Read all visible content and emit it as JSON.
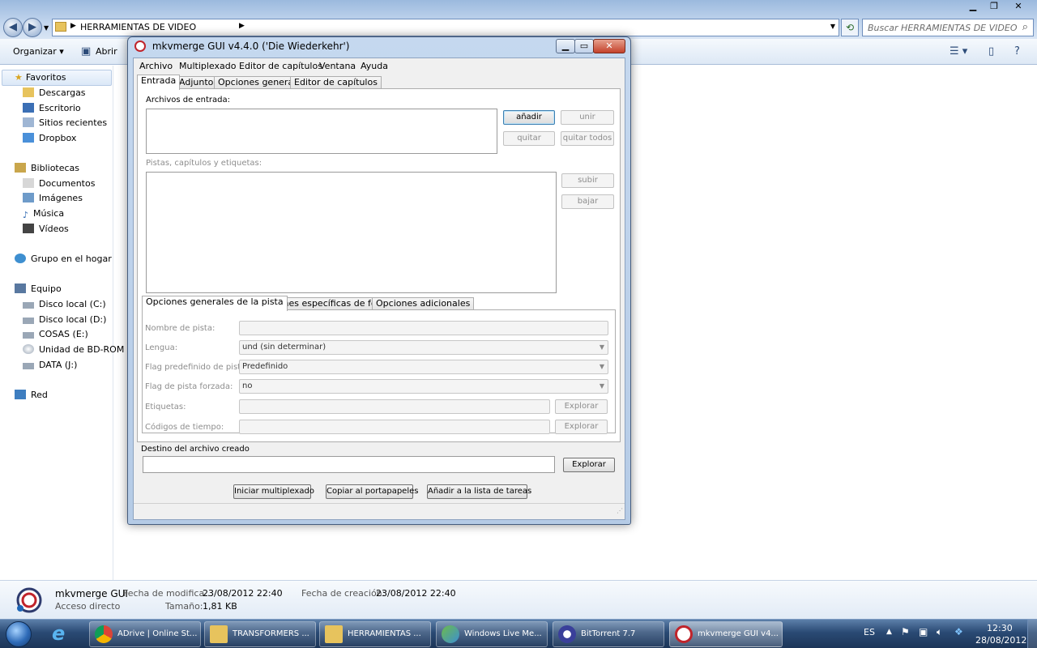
{
  "explorer": {
    "address_path": "HERRAMIENTAS DE VIDEO",
    "search_placeholder": "Buscar HERRAMIENTAS DE VIDEO",
    "commands": {
      "organize": "Organizar",
      "open": "Abrir"
    },
    "nav": {
      "favorites_header": "Favoritos",
      "favorites": [
        "Descargas",
        "Escritorio",
        "Sitios recientes",
        "Dropbox"
      ],
      "libraries_header": "Bibliotecas",
      "libraries": [
        "Documentos",
        "Imágenes",
        "Música",
        "Vídeos"
      ],
      "homegroup": "Grupo en el hogar",
      "computer_header": "Equipo",
      "drives": [
        "Disco local (C:)",
        "Disco local (D:)",
        "COSAS (E:)",
        "Unidad de BD-ROM",
        "DATA (J:)"
      ],
      "network": "Red"
    },
    "details": {
      "name": "mkvmerge GUI",
      "type": "Acceso directo",
      "modified_label": "Fecha de modifica...",
      "modified_value": "23/08/2012 22:40",
      "size_label": "Tamaño:",
      "size_value": "1,81 KB",
      "created_label": "Fecha de creación:",
      "created_value": "23/08/2012 22:40"
    }
  },
  "mkvmerge": {
    "title": "mkvmerge GUI v4.4.0 ('Die Wiederkehr')",
    "menu": [
      "Archivo",
      "Multiplexado",
      "Editor de capítulos",
      "Ventana",
      "Ayuda"
    ],
    "tabs": [
      "Entrada",
      "Adjuntos",
      "Opciones generales",
      "Editor de capítulos"
    ],
    "input_files_label": "Archivos de entrada:",
    "buttons": {
      "add": "añadir",
      "join": "unir",
      "remove": "quitar",
      "remove_all": "quitar todos",
      "up": "subir",
      "down": "bajar"
    },
    "tracks_label": "Pistas, capítulos y etiquetas:",
    "subtabs": [
      "Opciones generales de la pista",
      "Opciones específicas de formato",
      "Opciones adicionales"
    ],
    "track_fields": {
      "name_label": "Nombre de pista:",
      "language_label": "Lengua:",
      "language_value": "und (sin determinar)",
      "default_flag_label": "Flag predefinido de pista:",
      "default_flag_value": "Predefinido",
      "forced_flag_label": "Flag de pista forzada:",
      "forced_flag_value": "no",
      "tags_label": "Etiquetas:",
      "timecodes_label": "Códigos de tiempo:",
      "browse": "Explorar"
    },
    "destination_label": "Destino del archivo creado",
    "destination_browse": "Explorar",
    "actions": {
      "start": "Iniciar multiplexado",
      "copy": "Copiar al portapapeles",
      "queue": "Añadir a la lista de tareas"
    }
  },
  "taskbar": {
    "items": [
      {
        "label": "ADrive | Online St...",
        "icon": "chrome-icon"
      },
      {
        "label": "TRANSFORMERS ...",
        "icon": "folder-icon"
      },
      {
        "label": "HERRAMIENTAS ...",
        "icon": "folder-icon"
      },
      {
        "label": "Windows Live Me...",
        "icon": "messenger-icon"
      },
      {
        "label": "BitTorrent 7.7",
        "icon": "bittorrent-icon"
      },
      {
        "label": "mkvmerge GUI v4...",
        "icon": "mkvmerge-icon"
      }
    ],
    "language": "ES",
    "time": "12:30",
    "date": "28/08/2012"
  },
  "colors": {
    "taskbar": "#2a4a74",
    "window_frame": "#c5d8ef",
    "close_button": "#c4422b"
  }
}
